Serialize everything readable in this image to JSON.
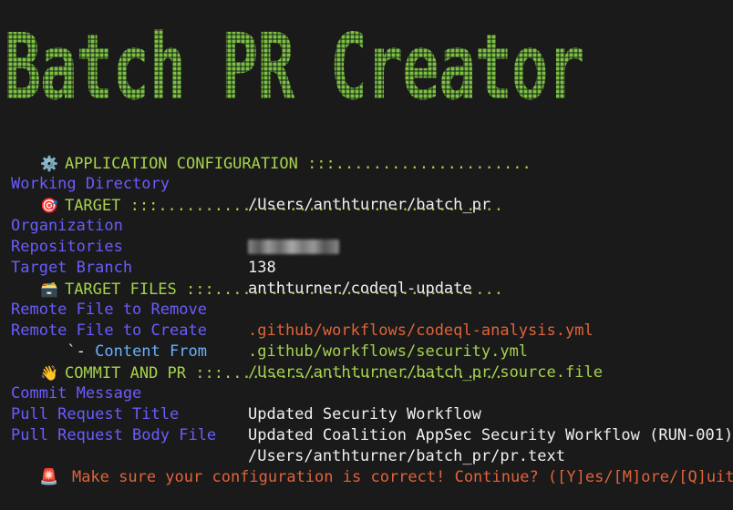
{
  "banner": {
    "title": "Batch PR Creator",
    "color": "#7bc142"
  },
  "sections": {
    "app_config": {
      "icon": "gear-icon",
      "icon_glyph": "⚙️",
      "header": "APPLICATION CONFIGURATION",
      "dots": " :::.....................",
      "rows": [
        {
          "label": "Working Directory",
          "value": "/Users/anthturner/batch_pr"
        }
      ]
    },
    "target": {
      "icon": "target-icon",
      "icon_glyph": "🎯",
      "header": "TARGET",
      "dots": " :::.....................................",
      "rows": [
        {
          "label": "Organization",
          "value": ""
        },
        {
          "label": "Repositories",
          "value": "138"
        },
        {
          "label": "Target Branch",
          "value": "anthturner/codeql-update"
        }
      ]
    },
    "target_files": {
      "icon": "box-icon",
      "icon_glyph": "🗃️",
      "header": "TARGET FILES",
      "dots": " :::...............................",
      "rows": [
        {
          "label": "Remote File to Remove",
          "value": ".github/workflows/codeql-analysis.yml"
        },
        {
          "label": "Remote File to Create",
          "value": ".github/workflows/security.yml"
        },
        {
          "label_prefix": "      `- ",
          "label": "Content From",
          "value": "/Users/anthturner/batch_pr/source.file"
        }
      ]
    },
    "commit_pr": {
      "icon": "wave-icon",
      "icon_glyph": "👋",
      "header": "COMMIT AND PR",
      "dots": " :::..............................",
      "rows": [
        {
          "label": "Commit Message",
          "value": "Updated Security Workflow"
        },
        {
          "label": "Pull Request Title",
          "value": "Updated Coalition AppSec Security Workflow (RUN-001)"
        },
        {
          "label": "Pull Request Body File",
          "value": "/Users/anthturner/batch_pr/pr.text"
        }
      ]
    }
  },
  "prompt": {
    "icon": "siren-icon",
    "icon_glyph": "🚨",
    "text": "Make sure your configuration is correct! Continue? ([Y]es/[M]ore/[Q]uit]"
  },
  "colors": {
    "background": "#1a1a1a",
    "header_green": "#a6d24e",
    "label_purple": "#6a5cff",
    "value_white": "#f0f0f0",
    "value_red": "#e0633a",
    "value_green": "#a6d24e",
    "sublabel_blue": "#6ab0ff"
  }
}
